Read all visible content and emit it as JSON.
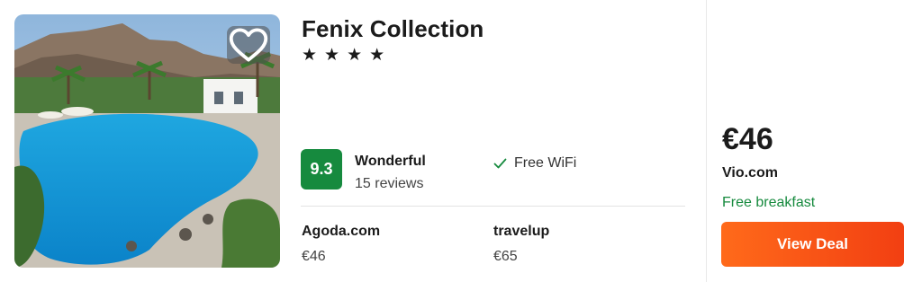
{
  "hotel": {
    "name": "Fenix Collection",
    "stars": 4,
    "star_glyph": "★",
    "favorite_icon": "heart-outline-icon"
  },
  "rating": {
    "score": "9.3",
    "label": "Wonderful",
    "reviews": "15 reviews",
    "badge_color": "#168a3e"
  },
  "amenities": [
    {
      "icon": "checkmark-icon",
      "label": "Free WiFi"
    }
  ],
  "other_offers": [
    {
      "provider": "Agoda.com",
      "price": "€46"
    },
    {
      "provider": "travelup",
      "price": "€65"
    }
  ],
  "best_deal": {
    "price": "€46",
    "provider": "Vio.com",
    "perk": "Free breakfast",
    "perk_color": "#168a3e",
    "button_label": "View Deal",
    "button_color": "#f4511e"
  }
}
